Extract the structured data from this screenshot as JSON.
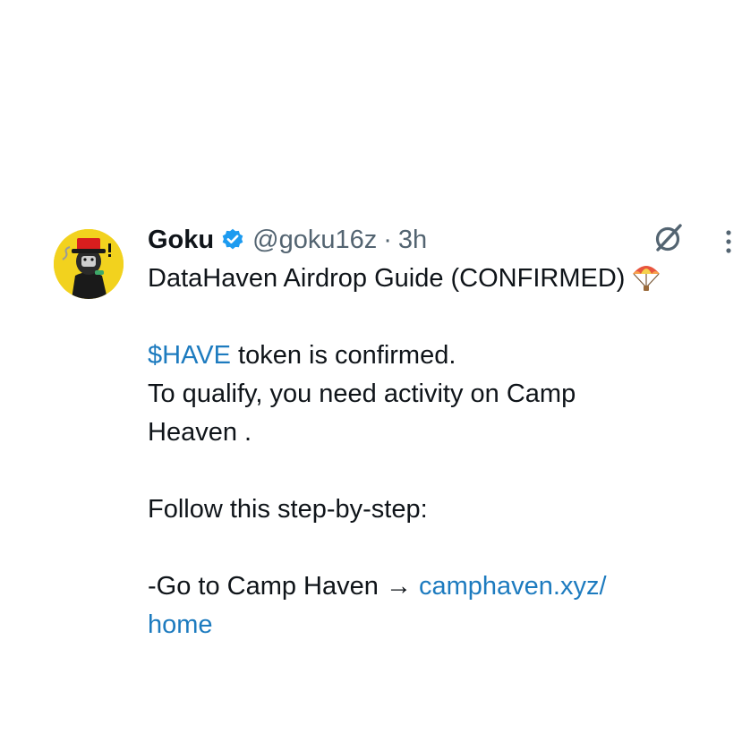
{
  "author": {
    "name": "Goku",
    "handle": "@goku16z",
    "separator": "·",
    "time": "3h",
    "verified": true,
    "avatar_icon": "cartoon-avatar-red-hat"
  },
  "icons": {
    "grok": "grok-icon",
    "more": "more-options-icon",
    "verified": "verified-badge-icon",
    "emoji": "parachute-emoji"
  },
  "colors": {
    "link": "#1d7bbf",
    "text": "#0f1419",
    "muted": "#536471",
    "verified": "#1d9bf0"
  },
  "tweet": {
    "title": "DataHaven Airdrop Guide (CONFIRMED)",
    "ticker": "$HAVE",
    "line2_rest": " token is confirmed.",
    "line3": "To qualify, you need activity on Camp",
    "line4": "Heaven .",
    "line5": "Follow this step-by-step:",
    "line6_prefix": "-Go to Camp Haven → ",
    "link_part1": "camphaven.xyz/",
    "link_part2": "home"
  }
}
